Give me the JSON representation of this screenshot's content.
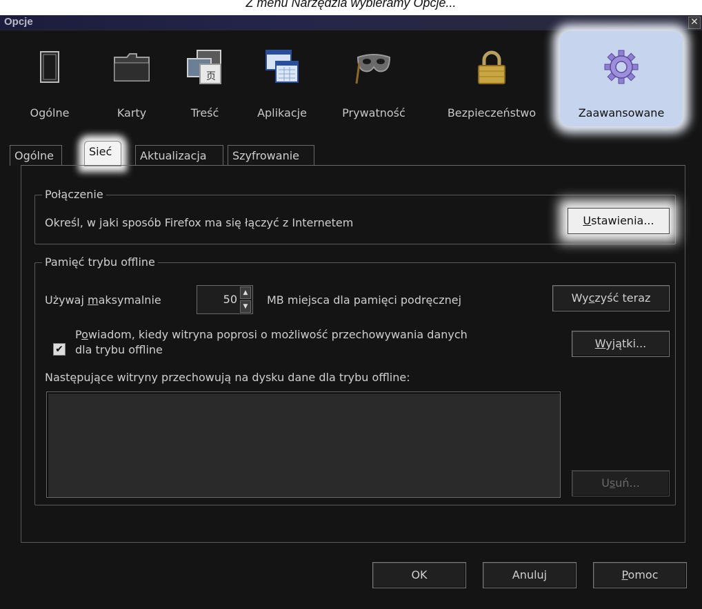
{
  "caption": "Z menu Narzędzia wybieramy Opcje...",
  "window": {
    "title": "Opcje",
    "close": "✕"
  },
  "toolbar": {
    "items": [
      {
        "label": "Ogólne",
        "icon": "window-icon"
      },
      {
        "label": "Karty",
        "icon": "folder-tab-icon"
      },
      {
        "label": "Treść",
        "icon": "content-icon"
      },
      {
        "label": "Aplikacje",
        "icon": "applications-icon"
      },
      {
        "label": "Prywatność",
        "icon": "mask-icon"
      },
      {
        "label": "Bezpieczeństwo",
        "icon": "padlock-icon"
      },
      {
        "label": "Zaawansowane",
        "icon": "gear-icon",
        "selected": true
      }
    ]
  },
  "tabs": [
    {
      "label": "Ogólne"
    },
    {
      "label": "Sieć",
      "selected": true
    },
    {
      "label": "Aktualizacja"
    },
    {
      "label": "Szyfrowanie"
    }
  ],
  "connection": {
    "title": "Połączenie",
    "description": "Określ, w jaki sposób Firefox ma się łączyć z Internetem",
    "settings_button": {
      "accel": "U",
      "rest": "stawienia..."
    }
  },
  "offline": {
    "title": "Pamięć trybu offline",
    "use_max": {
      "before": "Używaj ",
      "accel": "m",
      "after": "aksymalnie"
    },
    "size_value": "50",
    "size_suffix": "MB miejsca dla pamięci podręcznej",
    "clear_button": {
      "before": "Wy",
      "accel": "c",
      "after": "zyść teraz"
    },
    "notify_checked": true,
    "notify_line1": {
      "before": "P",
      "accel": "o",
      "after": "wiadom, kiedy witryna poprosi o możliwość przechowywania danych"
    },
    "notify_line2": "dla trybu offline",
    "exceptions_button": {
      "accel": "W",
      "rest": "yjątki..."
    },
    "sites_label": "Następujące witryny przechowują na dysku dane dla trybu offline:",
    "sites": [],
    "remove_button": {
      "before": "U",
      "accel": "s",
      "after": "uń..."
    }
  },
  "footer": {
    "ok": "OK",
    "cancel": "Anuluj",
    "help": {
      "accel": "P",
      "rest": "omoc"
    }
  },
  "colors": {
    "window_bg": "#141414",
    "selected_highlight": "#c7d4ee",
    "text": "#cfcfcf"
  }
}
